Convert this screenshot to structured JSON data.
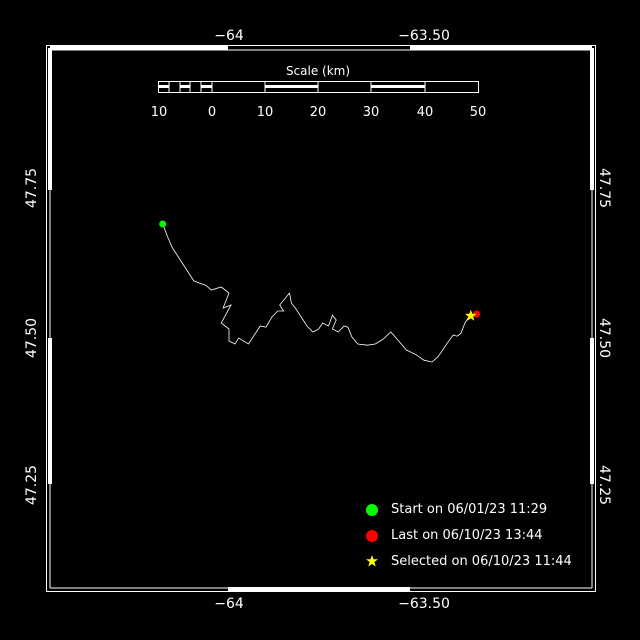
{
  "map": {
    "lon_range": [
      -64.4,
      -63.1
    ],
    "lat_range": [
      47.1,
      47.9
    ],
    "ticks_lon": [
      {
        "value": -64.0,
        "label": "−64"
      },
      {
        "value": -63.5,
        "label": "−63.50"
      }
    ],
    "ticks_lat": [
      {
        "value": 47.75,
        "label": "47.75"
      },
      {
        "value": 47.5,
        "label": "47.50"
      },
      {
        "value": 47.25,
        "label": "47.25"
      }
    ],
    "track": [
      [
        -64.17,
        47.69
      ],
      [
        -64.155,
        47.665
      ],
      [
        -64.145,
        47.65
      ],
      [
        -64.12,
        47.625
      ],
      [
        -64.1,
        47.605
      ],
      [
        -64.09,
        47.595
      ],
      [
        -64.06,
        47.588
      ],
      [
        -64.045,
        47.58
      ],
      [
        -64.02,
        47.585
      ],
      [
        -64.0,
        47.575
      ],
      [
        -64.015,
        47.55
      ],
      [
        -63.995,
        47.555
      ],
      [
        -64.02,
        47.525
      ],
      [
        -64.0,
        47.515
      ],
      [
        -64.0,
        47.495
      ],
      [
        -63.985,
        47.49
      ],
      [
        -63.975,
        47.5
      ],
      [
        -63.95,
        47.49
      ],
      [
        -63.935,
        47.505
      ],
      [
        -63.92,
        47.52
      ],
      [
        -63.905,
        47.518
      ],
      [
        -63.89,
        47.535
      ],
      [
        -63.875,
        47.545
      ],
      [
        -63.86,
        47.545
      ],
      [
        -63.87,
        47.555
      ],
      [
        -63.845,
        47.575
      ],
      [
        -63.84,
        47.558
      ],
      [
        -63.83,
        47.55
      ],
      [
        -63.815,
        47.535
      ],
      [
        -63.8,
        47.52
      ],
      [
        -63.785,
        47.51
      ],
      [
        -63.77,
        47.515
      ],
      [
        -63.76,
        47.525
      ],
      [
        -63.745,
        47.52
      ],
      [
        -63.735,
        47.538
      ],
      [
        -63.725,
        47.53
      ],
      [
        -63.735,
        47.515
      ],
      [
        -63.72,
        47.51
      ],
      [
        -63.705,
        47.52
      ],
      [
        -63.695,
        47.518
      ],
      [
        -63.685,
        47.502
      ],
      [
        -63.67,
        47.49
      ],
      [
        -63.645,
        47.488
      ],
      [
        -63.625,
        47.49
      ],
      [
        -63.605,
        47.498
      ],
      [
        -63.585,
        47.51
      ],
      [
        -63.565,
        47.495
      ],
      [
        -63.545,
        47.48
      ],
      [
        -63.52,
        47.472
      ],
      [
        -63.5,
        47.463
      ],
      [
        -63.48,
        47.46
      ],
      [
        -63.465,
        47.468
      ],
      [
        -63.45,
        47.482
      ],
      [
        -63.44,
        47.492
      ],
      [
        -63.425,
        47.505
      ],
      [
        -63.415,
        47.503
      ],
      [
        -63.405,
        47.508
      ],
      [
        -63.395,
        47.525
      ],
      [
        -63.38,
        47.54
      ]
    ],
    "start_point": [
      -64.17,
      47.69
    ],
    "last_point": [
      -63.365,
      47.54
    ],
    "selected_point": [
      -63.38,
      47.537
    ],
    "colors": {
      "start": "#00ff00",
      "last": "#ff0000",
      "selected": "#ffff00",
      "track": "#ffffff"
    }
  },
  "scale": {
    "title": "Scale (km)",
    "ticks": [
      "10",
      "0",
      "10",
      "20",
      "30",
      "40",
      "50"
    ]
  },
  "legend": {
    "start": {
      "label": "Start on 06/01/23 11:29",
      "icon": "green-dot"
    },
    "last": {
      "label": "Last on 06/10/23 13:44",
      "icon": "red-dot"
    },
    "selected": {
      "label": "Selected on 06/10/23 11:44",
      "icon": "yellow-star"
    }
  }
}
